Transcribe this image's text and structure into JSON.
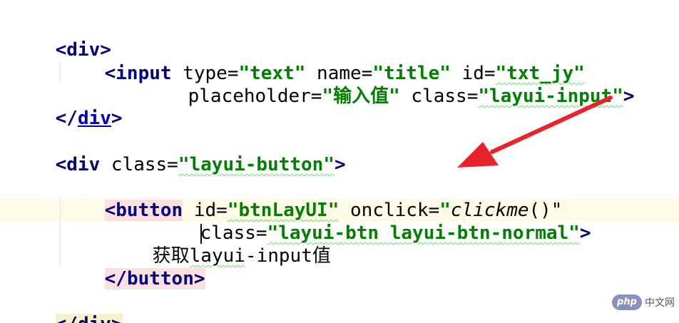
{
  "code": {
    "line1": {
      "open": "<",
      "tag": "div",
      "close": ">"
    },
    "line2": {
      "open": "<",
      "tag": "input",
      "attr_type": " type=",
      "val_type": "\"text\"",
      "attr_name": " name=",
      "val_name": "\"title\"",
      "attr_id": " id=",
      "val_id": "\"txt_jy\""
    },
    "line3": {
      "attr_placeholder": "placeholder=",
      "val_placeholder": "\"输入值\"",
      "attr_class": " class=",
      "val_class": "\"layui-input\"",
      "close": ">"
    },
    "line4": {
      "open": "</",
      "tag": "div",
      "close": ">"
    },
    "line5": {
      "open": "<",
      "tag": "div",
      "attr_class": " class=",
      "val_class": "\"layui-button\"",
      "close": ">"
    },
    "line6": {
      "open": "<",
      "tag": "button",
      "attr_id": " id=",
      "val_id": "\"btnLayUI\"",
      "attr_onclick": " onclick=",
      "val_q1": "\"",
      "val_fn": "clickme",
      "val_rest": "()\""
    },
    "line7": {
      "attr_class": "class=",
      "val_class": "\"layui-btn layui-btn-normal\"",
      "close": ">"
    },
    "line8": {
      "text_a": "获取",
      "text_b": "layui",
      "text_c": "-input值"
    },
    "line9": {
      "open": "</",
      "tag": "button",
      "close": ">"
    },
    "line10": {
      "open": "</",
      "tag": "div",
      "close": ">"
    }
  },
  "colors": {
    "tag": "#000080",
    "string": "#008000",
    "arrow": "#e8232a",
    "caret_line": "#fffbe6"
  },
  "watermark": {
    "logo_text": "php",
    "site_text": "中文网",
    "icon": "php-logo-icon"
  }
}
